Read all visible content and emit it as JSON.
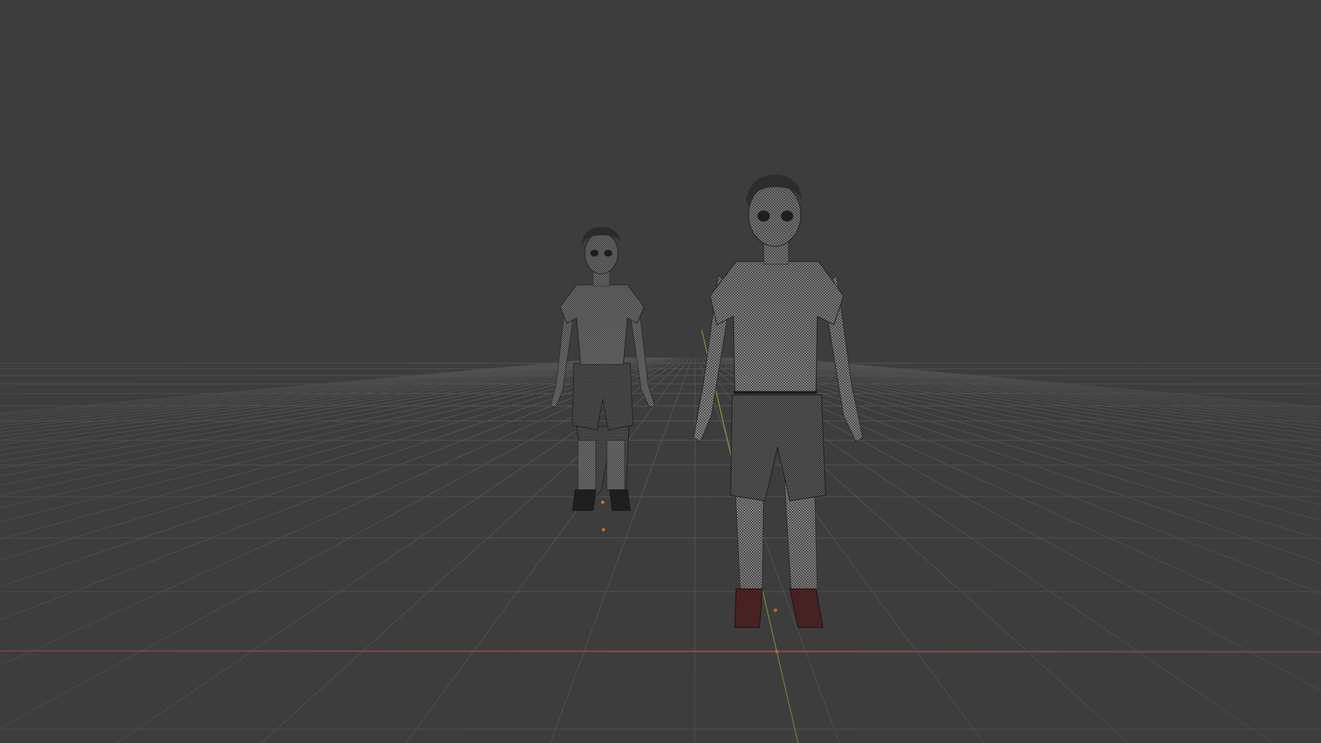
{
  "viewport": {
    "mode": "3d-viewport",
    "shading": "wireframe-overlay",
    "background_color": "#3d3d3d",
    "grid_color": "#555555",
    "x_axis_color": "#c44a4a",
    "y_axis_color": "#7ea33a"
  },
  "scene": {
    "objects": [
      {
        "name": "character-near",
        "type": "mesh",
        "selected": false
      },
      {
        "name": "character-far",
        "type": "mesh",
        "selected": false
      }
    ],
    "origin_markers_color": "#e0751d"
  }
}
